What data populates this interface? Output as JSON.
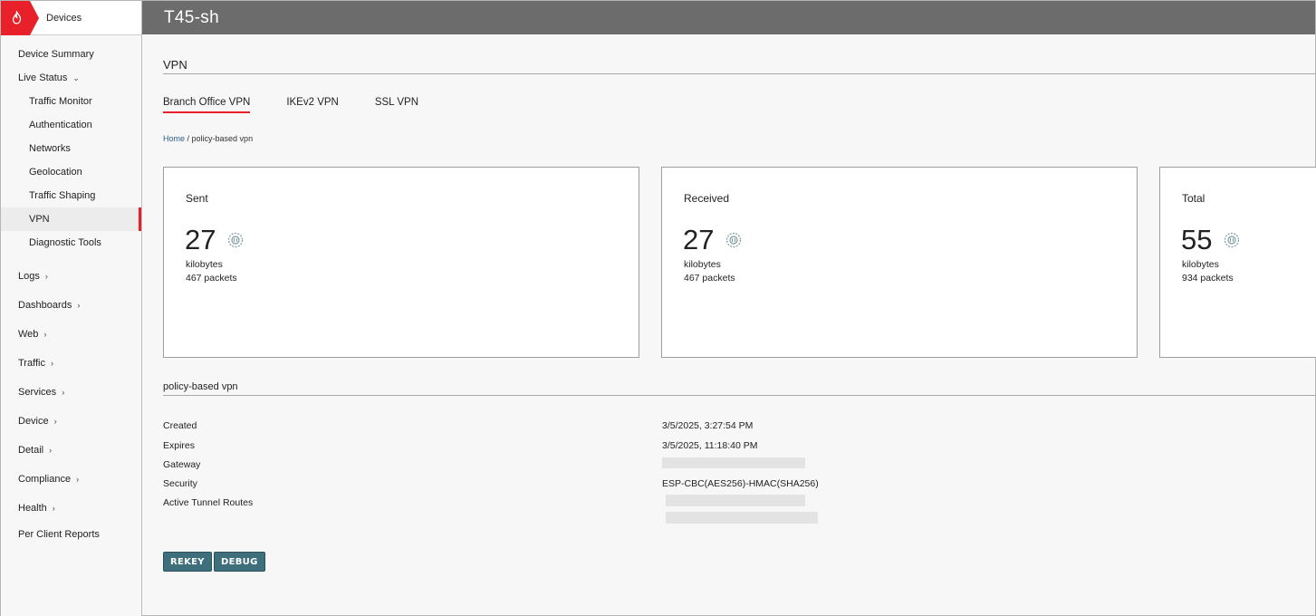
{
  "brand": {
    "title": "Devices"
  },
  "header": {
    "title": "T45-sh"
  },
  "sidebar": {
    "items": [
      {
        "label": "Device Summary",
        "level": "top"
      },
      {
        "label": "Live Status",
        "level": "top",
        "chevron": "v"
      },
      {
        "label": "Traffic Monitor",
        "level": "sub"
      },
      {
        "label": "Authentication",
        "level": "sub"
      },
      {
        "label": "Networks",
        "level": "sub"
      },
      {
        "label": "Geolocation",
        "level": "sub"
      },
      {
        "label": "Traffic Shaping",
        "level": "sub"
      },
      {
        "label": "VPN",
        "level": "sub",
        "active": true
      },
      {
        "label": "Diagnostic Tools",
        "level": "sub"
      },
      {
        "label": "Logs",
        "level": "top",
        "chevron": ">"
      },
      {
        "label": "Dashboards",
        "level": "top",
        "chevron": ">"
      },
      {
        "label": "Web",
        "level": "top",
        "chevron": ">"
      },
      {
        "label": "Traffic",
        "level": "top",
        "chevron": ">"
      },
      {
        "label": "Services",
        "level": "top",
        "chevron": ">"
      },
      {
        "label": "Device",
        "level": "top",
        "chevron": ">"
      },
      {
        "label": "Detail",
        "level": "top",
        "chevron": ">"
      },
      {
        "label": "Compliance",
        "level": "top",
        "chevron": ">"
      },
      {
        "label": "Health",
        "level": "top",
        "chevron": ">"
      },
      {
        "label": "Per Client Reports",
        "level": "top"
      }
    ]
  },
  "main": {
    "section_title": "VPN",
    "tabs": [
      {
        "label": "Branch Office VPN",
        "active": true
      },
      {
        "label": "IKEv2 VPN"
      },
      {
        "label": "SSL VPN"
      }
    ],
    "breadcrumb": {
      "home": "Home",
      "separator": " / ",
      "current": "policy-based vpn"
    },
    "cards": [
      {
        "title": "Sent",
        "value": "27",
        "unit": "kilobytes",
        "packets": "467 packets"
      },
      {
        "title": "Received",
        "value": "27",
        "unit": "kilobytes",
        "packets": "467 packets"
      },
      {
        "title": "Total",
        "value": "55",
        "unit": "kilobytes",
        "packets": "934 packets"
      }
    ],
    "detail": {
      "title": "policy-based vpn",
      "rows": [
        {
          "label": "Created",
          "value": "3/5/2025, 3:27:54 PM"
        },
        {
          "label": "Expires",
          "value": "3/5/2025, 11:18:40 PM"
        },
        {
          "label": "Gateway",
          "value": ""
        },
        {
          "label": "Security",
          "value": "ESP-CBC(AES256)-HMAC(SHA256)"
        },
        {
          "label": "Active Tunnel Routes",
          "value": ""
        }
      ]
    },
    "buttons": {
      "rekey": "REKEY",
      "debug": "DEBUG"
    }
  },
  "colors": {
    "accent": "#e8202a",
    "header": "#6c6c6c",
    "button": "#3d6f7c"
  }
}
